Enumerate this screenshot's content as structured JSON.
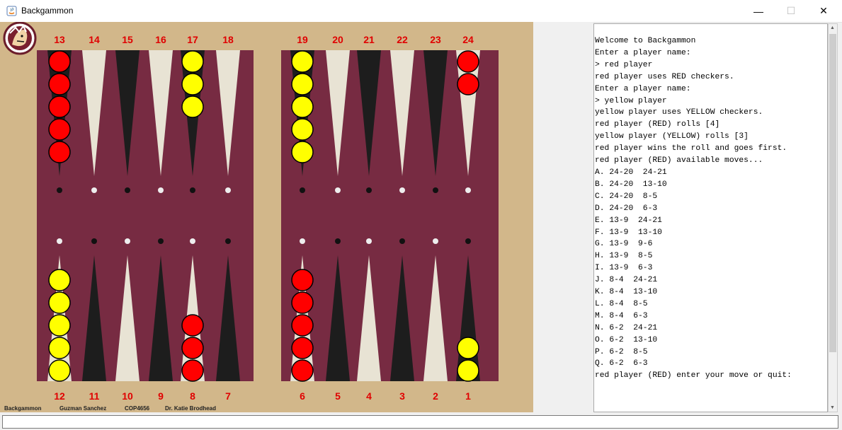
{
  "window": {
    "title": "Backgammon",
    "controls": [
      "—",
      "☐",
      "✕"
    ]
  },
  "colors": {
    "board_bg": "#d2b78a",
    "felt": "#772b42",
    "dark_point": "#1d1d1d",
    "light_point": "#e8e3d4",
    "red_checker": "#ff0000",
    "yellow_checker": "#ffff00",
    "point_number": "#e00000"
  },
  "logo_icon": "seminole-head-logo",
  "board": {
    "top_numbers": [
      "13",
      "14",
      "15",
      "16",
      "17",
      "18",
      "19",
      "20",
      "21",
      "22",
      "23",
      "24"
    ],
    "bottom_numbers": [
      "12",
      "11",
      "10",
      "9",
      "8",
      "7",
      "6",
      "5",
      "4",
      "3",
      "2",
      "1"
    ],
    "top_checkers": [
      {
        "color": "red",
        "count": 5
      },
      {
        "color": "none",
        "count": 0
      },
      {
        "color": "none",
        "count": 0
      },
      {
        "color": "none",
        "count": 0
      },
      {
        "color": "yellow",
        "count": 3
      },
      {
        "color": "none",
        "count": 0
      },
      {
        "color": "yellow",
        "count": 5
      },
      {
        "color": "none",
        "count": 0
      },
      {
        "color": "none",
        "count": 0
      },
      {
        "color": "none",
        "count": 0
      },
      {
        "color": "none",
        "count": 0
      },
      {
        "color": "red",
        "count": 2
      }
    ],
    "bottom_checkers": [
      {
        "color": "yellow",
        "count": 5
      },
      {
        "color": "none",
        "count": 0
      },
      {
        "color": "none",
        "count": 0
      },
      {
        "color": "none",
        "count": 0
      },
      {
        "color": "red",
        "count": 3
      },
      {
        "color": "none",
        "count": 0
      },
      {
        "color": "red",
        "count": 5
      },
      {
        "color": "none",
        "count": 0
      },
      {
        "color": "none",
        "count": 0
      },
      {
        "color": "none",
        "count": 0
      },
      {
        "color": "none",
        "count": 0
      },
      {
        "color": "yellow",
        "count": 2
      }
    ]
  },
  "footer": {
    "items": [
      "Backgammon",
      "Guzman Sanchez",
      "COP4656",
      "Dr. Katie Brodhead"
    ]
  },
  "console": {
    "lines": [
      "Welcome to Backgammon",
      "Enter a player name:",
      "> red player",
      "red player uses RED checkers.",
      "Enter a player name:",
      "> yellow player",
      "yellow player uses YELLOW checkers.",
      "red player (RED) rolls [4]",
      "yellow player (YELLOW) rolls [3]",
      "red player wins the roll and goes first.",
      "red player (RED) available moves...",
      "A. 24-20  24-21",
      "B. 24-20  13-10",
      "C. 24-20  8-5",
      "D. 24-20  6-3",
      "E. 13-9  24-21",
      "F. 13-9  13-10",
      "G. 13-9  9-6",
      "H. 13-9  8-5",
      "I. 13-9  6-3",
      "J. 8-4  24-21",
      "K. 8-4  13-10",
      "L. 8-4  8-5",
      "M. 8-4  6-3",
      "N. 6-2  24-21",
      "O. 6-2  13-10",
      "P. 6-2  8-5",
      "Q. 6-2  6-3",
      "red player (RED) enter your move or quit:"
    ]
  },
  "input": {
    "value": ""
  }
}
